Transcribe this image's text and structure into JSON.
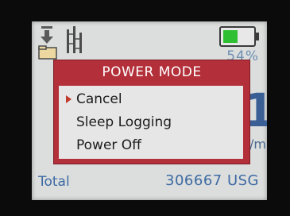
{
  "status": {
    "battery_percent_text": "54%",
    "battery_level": 0.54,
    "battery_color": "#2fbf32",
    "icons": [
      "download-arrow-icon",
      "folder-icon",
      "signal-bars-icon",
      "battery-icon"
    ]
  },
  "background": {
    "partial_digit": "1",
    "partial_unit": "/m"
  },
  "dialog": {
    "title": "POWER MODE",
    "items": [
      {
        "label": "Cancel",
        "selected": true
      },
      {
        "label": "Sleep Logging",
        "selected": false
      },
      {
        "label": "Power Off",
        "selected": false
      }
    ],
    "accent_color": "#b3303a"
  },
  "footer": {
    "total_label": "Total",
    "total_value": "306667 USG"
  }
}
